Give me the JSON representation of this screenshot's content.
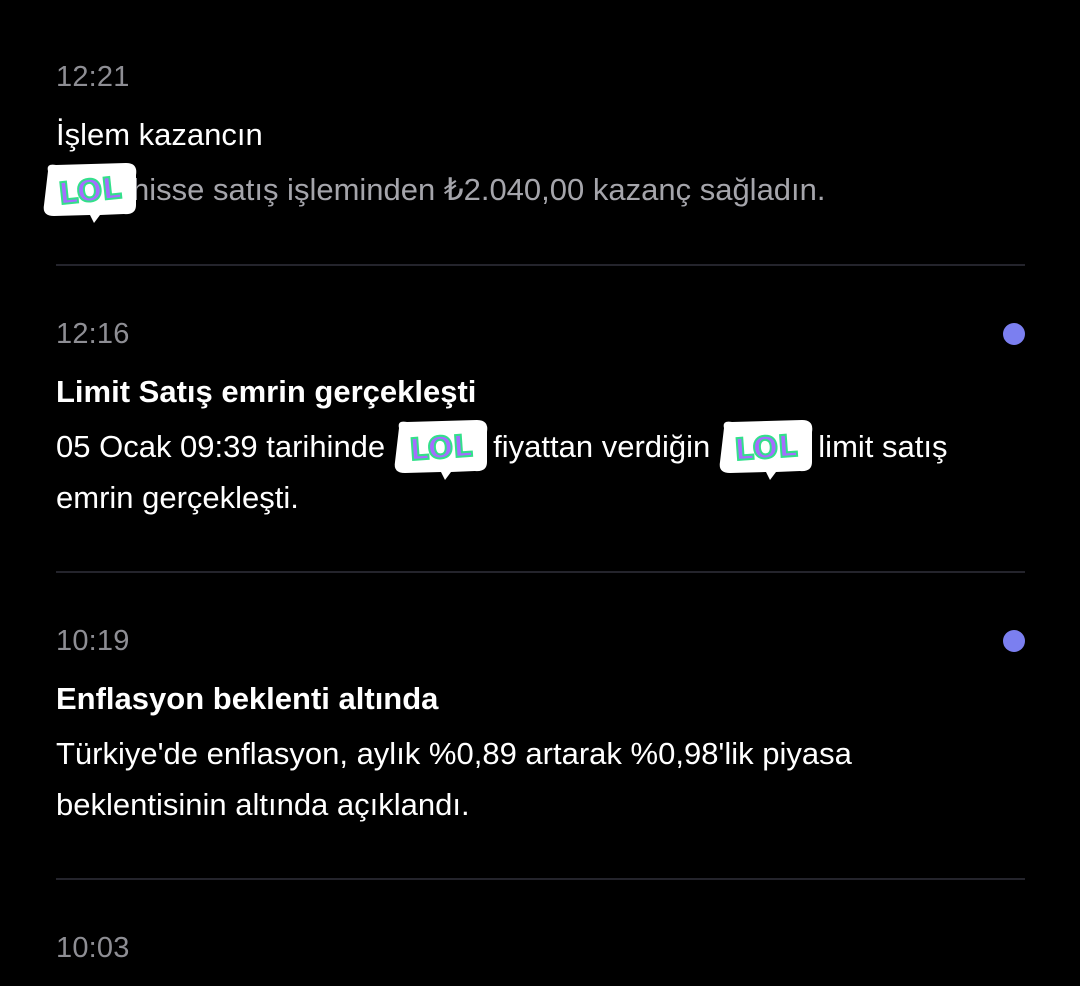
{
  "notifications": [
    {
      "time": "12:21",
      "title": "İşlem kazancın",
      "body_after": "hisse satış işleminden ₺2.040,00 kazanç sağladın.",
      "unread": false
    },
    {
      "time": "12:16",
      "title": "Limit Satış emrin gerçekleşti",
      "body_part1": "05 Ocak 09:39 tarihinde",
      "body_part2": "fiyattan verdiğin",
      "body_part3": "limit satış emrin gerçekleşti.",
      "unread": true
    },
    {
      "time": "10:19",
      "title": "Enflasyon beklenti altında",
      "body": "Türkiye'de enflasyon, aylık %0,89 artarak %0,98'lik piyasa beklentisinin altında açıklandı.",
      "unread": true
    },
    {
      "time": "10:03"
    }
  ],
  "sticker": {
    "text": "LOL",
    "icon": "lol-sticker-icon",
    "fill": "#a66cff",
    "stroke": "#33e08a"
  },
  "colors": {
    "background": "#000000",
    "time": "#8e8e94",
    "title": "#ffffff",
    "body_dim": "#a5a5ab",
    "unread_dot": "#7b7ff0",
    "divider": "#24242c"
  }
}
